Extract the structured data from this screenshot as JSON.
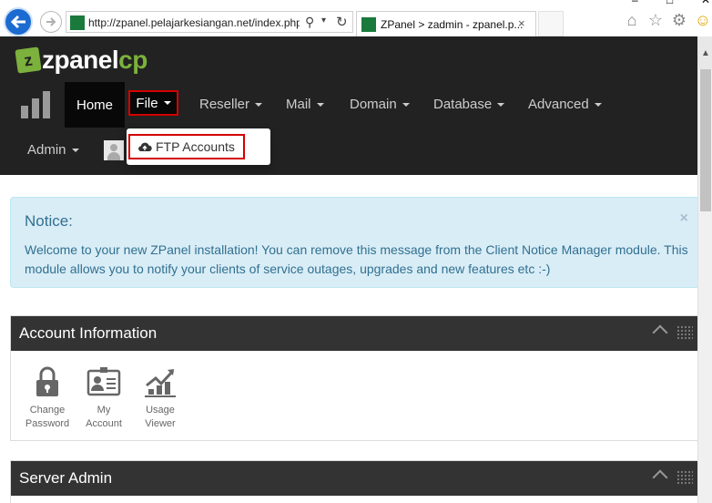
{
  "browser": {
    "url": "http://zpanel.pelajarkesiangan.net/index.php",
    "tab_title": "ZPanel > zadmin - zpanel.p...",
    "tab_close": "×",
    "search_symbol": "⚲",
    "refresh_symbol": "↻",
    "home_icon": "⌂",
    "favorites_icon": "☆",
    "settings_icon": "⚙",
    "feedback_icon": "☺"
  },
  "window_controls": {
    "minimize": "–",
    "maximize": "□",
    "close": "✕"
  },
  "logo": {
    "z": "z",
    "text": "zpanel",
    "cp": "cp"
  },
  "nav": {
    "items": [
      {
        "label": "Home"
      },
      {
        "label": "File"
      },
      {
        "label": "Reseller"
      },
      {
        "label": "Mail"
      },
      {
        "label": "Domain"
      },
      {
        "label": "Database"
      },
      {
        "label": "Advanced"
      },
      {
        "label": "Admin"
      }
    ],
    "file_menu": [
      {
        "label": "FTP Accounts",
        "icon": "cloud-upload-icon"
      }
    ]
  },
  "notice": {
    "title": "Notice:",
    "body": "Welcome to your new ZPanel installation! You can remove this message from the Client Notice Manager module. This module allows you to notify your clients of service outages, upgrades and new features etc :-)",
    "close": "×"
  },
  "panels": {
    "account": {
      "title": "Account Information",
      "tiles": [
        {
          "label": "Change Password",
          "icon": "lock-icon"
        },
        {
          "label": "My Account",
          "icon": "id-card-icon"
        },
        {
          "label": "Usage Viewer",
          "icon": "chart-icon"
        }
      ]
    },
    "server": {
      "title": "Server Admin"
    }
  },
  "colors": {
    "navbar": "#222222",
    "accent": "#7bb13c",
    "highlight": "#d30000",
    "notice_bg": "#d9edf7",
    "notice_text": "#31708f"
  }
}
